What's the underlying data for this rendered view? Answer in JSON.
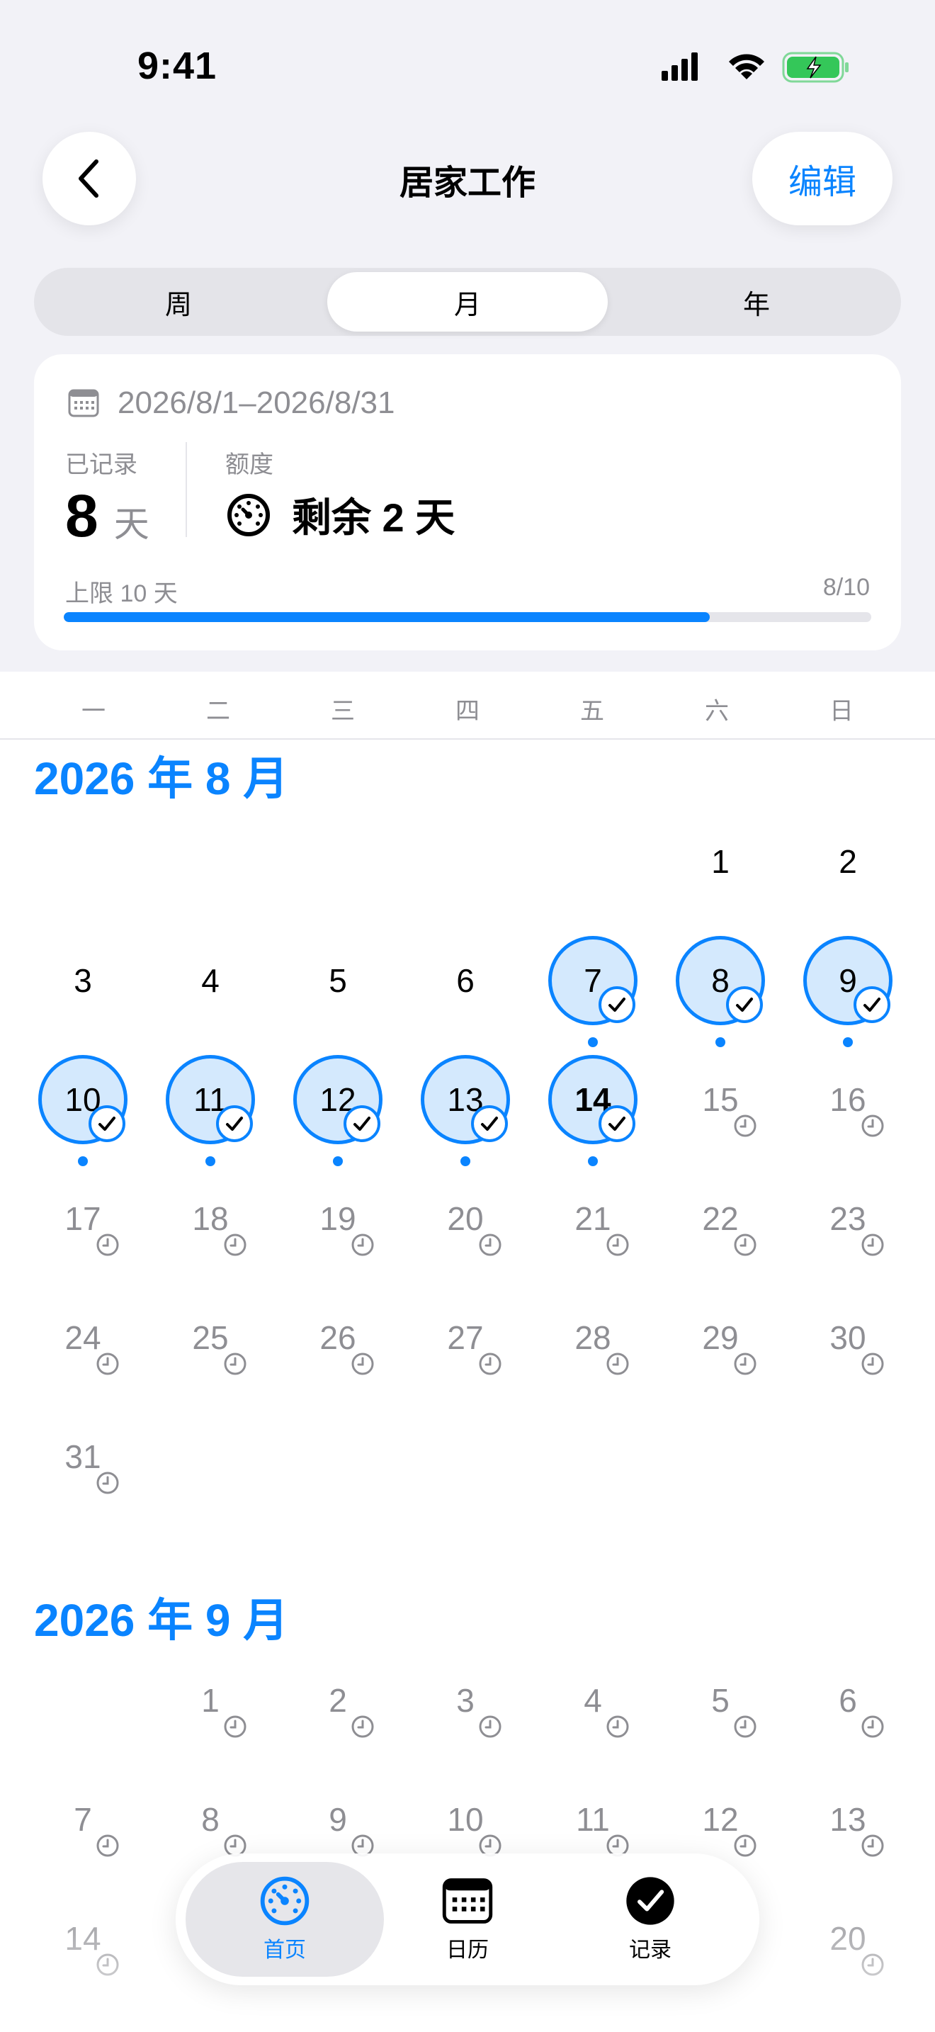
{
  "status_bar": {
    "time": "9:41"
  },
  "nav": {
    "title": "居家工作",
    "edit_label": "编辑"
  },
  "segments": [
    {
      "label": "周",
      "active": false
    },
    {
      "label": "月",
      "active": true
    },
    {
      "label": "年",
      "active": false
    }
  ],
  "summary": {
    "date_range": "2026/8/1–2026/8/31",
    "recorded_label": "已记录",
    "recorded_value": "8",
    "recorded_unit": "天",
    "quota_label": "额度",
    "quota_value": "剩余 2 天",
    "limit_label": "上限 10 天",
    "limit_count": "8/10",
    "progress_fraction": 0.8
  },
  "weekdays": [
    "一",
    "二",
    "三",
    "四",
    "五",
    "六",
    "日"
  ],
  "months": [
    {
      "title": "2026 年 8 月",
      "first_weekday_index": 5,
      "days": [
        {
          "d": "1",
          "s": "past"
        },
        {
          "d": "2",
          "s": "past"
        },
        {
          "d": "3",
          "s": "past"
        },
        {
          "d": "4",
          "s": "past"
        },
        {
          "d": "5",
          "s": "past"
        },
        {
          "d": "6",
          "s": "past"
        },
        {
          "d": "7",
          "s": "done"
        },
        {
          "d": "8",
          "s": "done"
        },
        {
          "d": "9",
          "s": "done"
        },
        {
          "d": "10",
          "s": "done"
        },
        {
          "d": "11",
          "s": "done"
        },
        {
          "d": "12",
          "s": "done"
        },
        {
          "d": "13",
          "s": "done"
        },
        {
          "d": "14",
          "s": "today"
        },
        {
          "d": "15",
          "s": "future"
        },
        {
          "d": "16",
          "s": "future"
        },
        {
          "d": "17",
          "s": "future"
        },
        {
          "d": "18",
          "s": "future"
        },
        {
          "d": "19",
          "s": "future"
        },
        {
          "d": "20",
          "s": "future"
        },
        {
          "d": "21",
          "s": "future"
        },
        {
          "d": "22",
          "s": "future"
        },
        {
          "d": "23",
          "s": "future"
        },
        {
          "d": "24",
          "s": "future"
        },
        {
          "d": "25",
          "s": "future"
        },
        {
          "d": "26",
          "s": "future"
        },
        {
          "d": "27",
          "s": "future"
        },
        {
          "d": "28",
          "s": "future"
        },
        {
          "d": "29",
          "s": "future"
        },
        {
          "d": "30",
          "s": "future"
        },
        {
          "d": "31",
          "s": "future"
        }
      ]
    },
    {
      "title": "2026 年 9 月",
      "first_weekday_index": 1,
      "days": [
        {
          "d": "1",
          "s": "future"
        },
        {
          "d": "2",
          "s": "future"
        },
        {
          "d": "3",
          "s": "future"
        },
        {
          "d": "4",
          "s": "future"
        },
        {
          "d": "5",
          "s": "future"
        },
        {
          "d": "6",
          "s": "future"
        },
        {
          "d": "7",
          "s": "future"
        },
        {
          "d": "8",
          "s": "future"
        },
        {
          "d": "9",
          "s": "future"
        },
        {
          "d": "10",
          "s": "future"
        },
        {
          "d": "11",
          "s": "future"
        },
        {
          "d": "12",
          "s": "future"
        },
        {
          "d": "13",
          "s": "future"
        },
        {
          "d": "14",
          "s": "future"
        },
        {
          "d": "20",
          "s": "future"
        }
      ]
    }
  ],
  "tabbar": [
    {
      "label": "首页",
      "icon": "gauge-icon",
      "active": true
    },
    {
      "label": "日历",
      "icon": "calendar-icon",
      "active": false
    },
    {
      "label": "记录",
      "icon": "checkmark-circle-icon",
      "active": false
    }
  ],
  "colors": {
    "accent": "#0a84ff",
    "done_fill": "#d4e9fd",
    "muted": "#8e8e93"
  }
}
